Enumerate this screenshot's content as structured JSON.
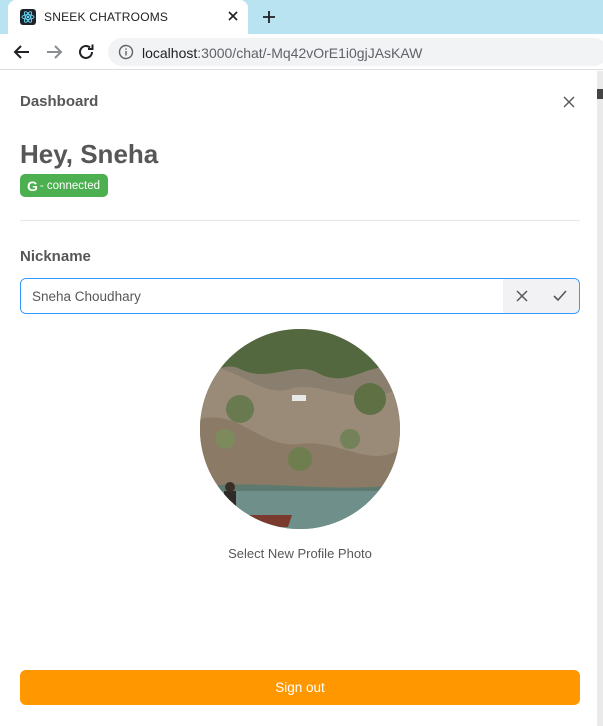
{
  "browser": {
    "tab_title": "SNEEK CHATROOMS",
    "url_host": "localhost",
    "url_rest": ":3000/chat/-Mq42vOrE1i0gjJAsKAW"
  },
  "drawer": {
    "title": "Dashboard",
    "greeting": "Hey, Sneha",
    "badge": {
      "icon": "google-icon",
      "glyph": "G",
      "label": "- connected",
      "color": "#4caf50"
    },
    "nickname": {
      "label": "Nickname",
      "value": "Sneha Choudhary"
    },
    "avatar_caption": "Select New Profile Photo",
    "signout_label": "Sign out"
  },
  "colors": {
    "accent_blue": "#3498ff",
    "signout_orange": "#ff9800",
    "tabstrip": "#b9e3f0"
  }
}
